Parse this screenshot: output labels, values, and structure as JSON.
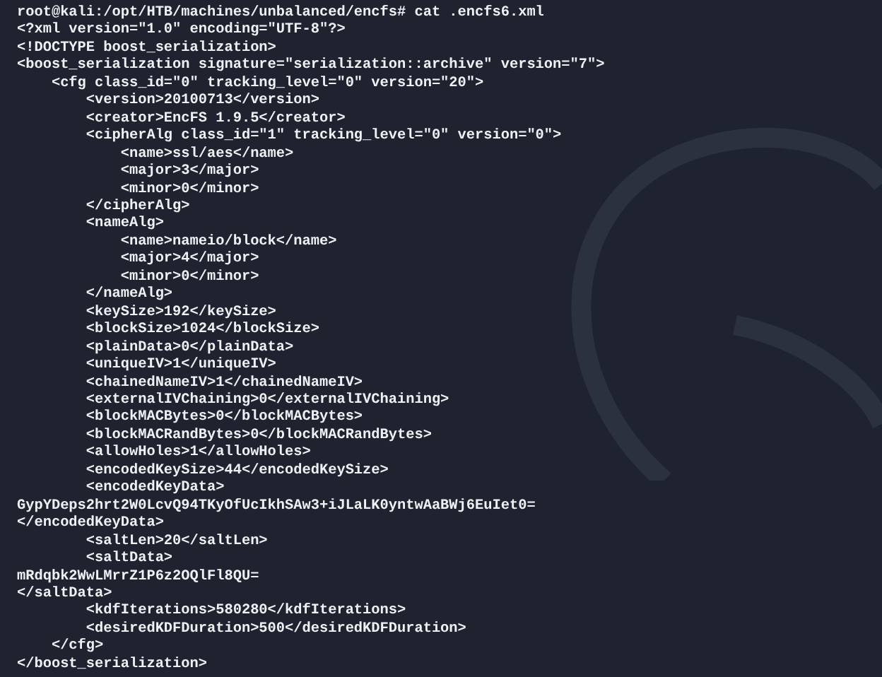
{
  "terminal": {
    "lines": [
      "root@kali:/opt/HTB/machines/unbalanced/encfs# cat .encfs6.xml",
      "<?xml version=\"1.0\" encoding=\"UTF-8\"?>",
      "<!DOCTYPE boost_serialization>",
      "<boost_serialization signature=\"serialization::archive\" version=\"7\">",
      "    <cfg class_id=\"0\" tracking_level=\"0\" version=\"20\">",
      "        <version>20100713</version>",
      "        <creator>EncFS 1.9.5</creator>",
      "        <cipherAlg class_id=\"1\" tracking_level=\"0\" version=\"0\">",
      "            <name>ssl/aes</name>",
      "            <major>3</major>",
      "            <minor>0</minor>",
      "        </cipherAlg>",
      "        <nameAlg>",
      "            <name>nameio/block</name>",
      "            <major>4</major>",
      "            <minor>0</minor>",
      "        </nameAlg>",
      "        <keySize>192</keySize>",
      "        <blockSize>1024</blockSize>",
      "        <plainData>0</plainData>",
      "        <uniqueIV>1</uniqueIV>",
      "        <chainedNameIV>1</chainedNameIV>",
      "        <externalIVChaining>0</externalIVChaining>",
      "        <blockMACBytes>0</blockMACBytes>",
      "        <blockMACRandBytes>0</blockMACRandBytes>",
      "        <allowHoles>1</allowHoles>",
      "        <encodedKeySize>44</encodedKeySize>",
      "        <encodedKeyData>",
      "GypYDeps2hrt2W0LcvQ94TKyOfUcIkhSAw3+iJLaLK0yntwAaBWj6EuIet0=",
      "</encodedKeyData>",
      "        <saltLen>20</saltLen>",
      "        <saltData>",
      "mRdqbk2WwLMrrZ1P6z2OQlFl8QU=",
      "</saltData>",
      "        <kdfIterations>580280</kdfIterations>",
      "        <desiredKDFDuration>500</desiredKDFDuration>",
      "    </cfg>",
      "</boost_serialization>"
    ]
  }
}
